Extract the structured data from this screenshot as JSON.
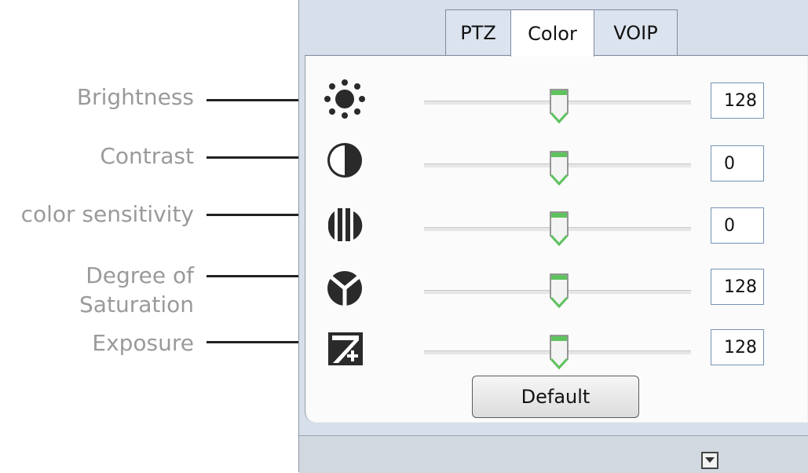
{
  "annotations": {
    "brightness": "Brightness",
    "contrast": "Contrast",
    "color_sensitivity": "color sensitivity",
    "saturation_line1": "Degree of",
    "saturation_line2": "Saturation",
    "exposure": "Exposure"
  },
  "tabs": [
    {
      "label": "PTZ",
      "active": false
    },
    {
      "label": "Color",
      "active": true
    },
    {
      "label": "VOIP",
      "active": false
    }
  ],
  "controls": [
    {
      "name": "brightness",
      "icon": "sun-icon",
      "value": "128",
      "slider_fraction": 0.5
    },
    {
      "name": "contrast",
      "icon": "contrast-icon",
      "value": "0",
      "slider_fraction": 0.5
    },
    {
      "name": "color-sensitivity",
      "icon": "hue-bars-icon",
      "value": "0",
      "slider_fraction": 0.5
    },
    {
      "name": "saturation",
      "icon": "saturation-icon",
      "value": "128",
      "slider_fraction": 0.5
    },
    {
      "name": "exposure",
      "icon": "exposure-icon",
      "value": "128",
      "slider_fraction": 0.5
    }
  ],
  "default_button": "Default",
  "colors": {
    "thumb_accent": "#5ec35e",
    "panel_bg": "#d7dfea",
    "value_border": "#7592b6"
  }
}
